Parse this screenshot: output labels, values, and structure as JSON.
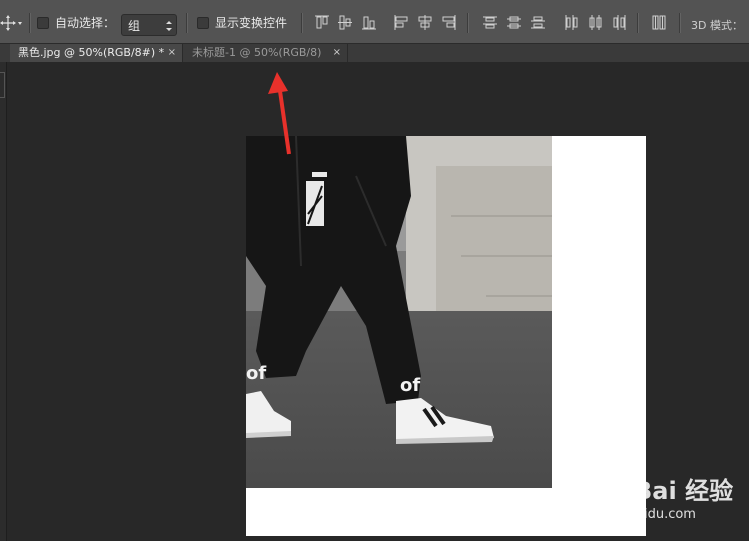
{
  "toolbar": {
    "move_tool_icon": "move-tool-icon",
    "auto_select_label": "自动选择：",
    "auto_select_checked": false,
    "auto_select_value": "组",
    "show_transform_label": "显示变换控件",
    "show_transform_checked": false,
    "align_icons": [
      "align-top-icon",
      "align-vcenter-icon",
      "align-bottom-icon",
      "align-left-icon",
      "align-hcenter-icon",
      "align-right-icon",
      "distribute-top-icon",
      "distribute-vcenter-icon",
      "distribute-bottom-icon",
      "distribute-left-icon",
      "distribute-hcenter-icon",
      "distribute-right-icon",
      "auto-align-icon"
    ],
    "mode_label": "3D 模式："
  },
  "tabs": [
    {
      "label": "黑色.jpg @ 50%(RGB/8#) *",
      "active": true,
      "close": "×"
    },
    {
      "label": "未标题-1 @ 50%(RGB/8)",
      "active": false,
      "close": "×"
    }
  ],
  "annotation": {
    "color": "#e8312b"
  },
  "watermark": {
    "text": "Bai 经验",
    "url": "jingyan.baidu.com"
  },
  "colors": {
    "toolbar": "#535353",
    "workspace": "#282828",
    "canvas": "#ffffff"
  }
}
